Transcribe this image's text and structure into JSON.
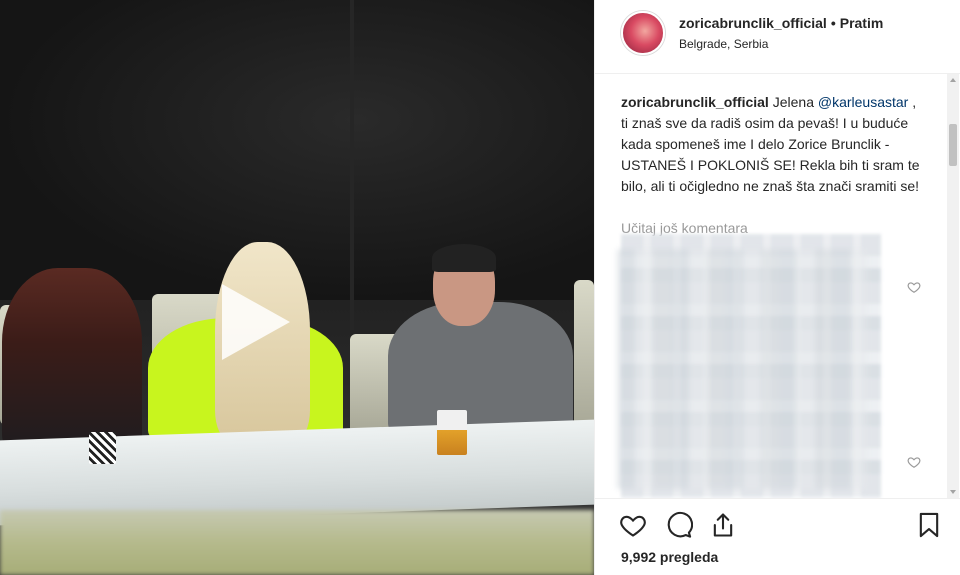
{
  "post": {
    "username": "zoricabrunclik_official",
    "separator": "•",
    "follow_label": "Pratim",
    "location": "Belgrade, Serbia"
  },
  "caption": {
    "username": "zoricabrunclik_official",
    "text_start": "Jelena",
    "mention": "@karleusastar",
    "text_rest": ", ti znaš sve da radiš osim da pevaš! I u buduće kada spomeneš ime I delo Zorice Brunclik - USTANEŠ I POKLONIŠ SE! Rekla bih ti sram te bilo, ali ti očigledno ne znaš šta znači sramiti se!"
  },
  "comments": {
    "load_more": "Učitaj još komentara"
  },
  "stats": {
    "views": "9,992 pregleda"
  },
  "icons": {
    "like": "heart-icon",
    "comment": "comment-icon",
    "share": "share-icon",
    "save": "bookmark-icon",
    "play": "play-icon"
  }
}
